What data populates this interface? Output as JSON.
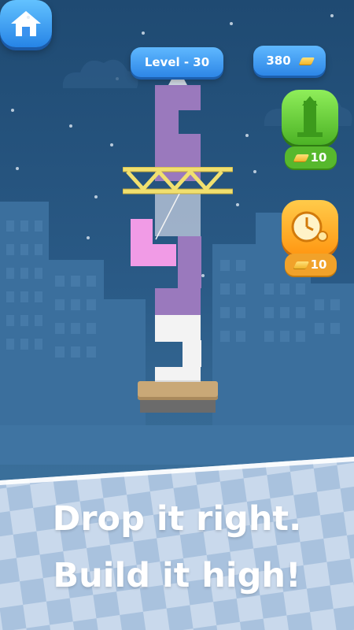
{
  "hud": {
    "level_label": "Level - 30",
    "coins": "380"
  },
  "powerups": [
    {
      "name": "tower-grow",
      "cost": "10",
      "color": "#6ed63a"
    },
    {
      "name": "slow-time",
      "cost": "10",
      "color": "#ffa61f"
    }
  ],
  "caption": {
    "line1": "Drop it right.",
    "line2": "Build it high!"
  },
  "colors": {
    "sky": "#244f7a",
    "purple_block": "#9a79bd",
    "pink_block": "#f19be6",
    "white_block": "#f3f3f3",
    "crane": "#f1e06f",
    "accent_blue": "#3a92ee"
  }
}
